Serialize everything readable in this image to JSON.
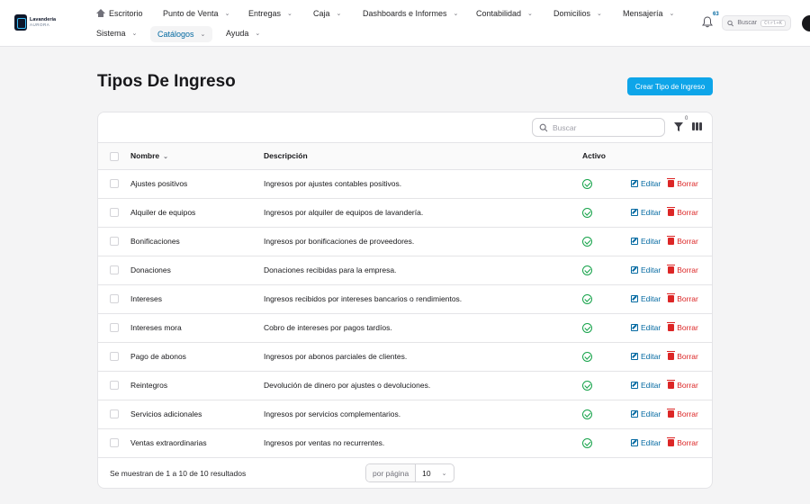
{
  "brand": {
    "name_line1": "Lavandería",
    "name_line2": "AURORA"
  },
  "nav": {
    "items": [
      {
        "label": "Escritorio"
      },
      {
        "label": "Punto de Venta"
      },
      {
        "label": "Entregas"
      },
      {
        "label": "Caja"
      },
      {
        "label": "Dashboards e Informes"
      },
      {
        "label": "Contabilidad"
      },
      {
        "label": "Domicilios"
      },
      {
        "label": "Mensajería"
      },
      {
        "label": "Sistema"
      },
      {
        "label": "Catálogos"
      },
      {
        "label": "Ayuda"
      }
    ],
    "active": "Catálogos",
    "notifications_count": "63",
    "search_label": "Buscar",
    "search_shortcut": "Ctrl+K"
  },
  "page": {
    "title": "Tipos De Ingreso",
    "create_button": "Crear Tipo de Ingreso"
  },
  "table": {
    "search_placeholder": "Buscar",
    "filter_count": "0",
    "columns": {
      "name": "Nombre",
      "description": "Descripción",
      "active": "Activo"
    },
    "edit_label": "Editar",
    "delete_label": "Borrar",
    "rows": [
      {
        "name": "Ajustes positivos",
        "description": "Ingresos por ajustes contables positivos.",
        "active": true
      },
      {
        "name": "Alquiler de equipos",
        "description": "Ingresos por alquiler de equipos de lavandería.",
        "active": true
      },
      {
        "name": "Bonificaciones",
        "description": "Ingresos por bonificaciones de proveedores.",
        "active": true
      },
      {
        "name": "Donaciones",
        "description": "Donaciones recibidas para la empresa.",
        "active": true
      },
      {
        "name": "Intereses",
        "description": "Ingresos recibidos por intereses bancarios o rendimientos.",
        "active": true
      },
      {
        "name": "Intereses mora",
        "description": "Cobro de intereses por pagos tardíos.",
        "active": true
      },
      {
        "name": "Pago de abonos",
        "description": "Ingresos por abonos parciales de clientes.",
        "active": true
      },
      {
        "name": "Reintegros",
        "description": "Devolución de dinero por ajustes o devoluciones.",
        "active": true
      },
      {
        "name": "Servicios adicionales",
        "description": "Ingresos por servicios complementarios.",
        "active": true
      },
      {
        "name": "Ventas extraordinarias",
        "description": "Ingresos por ventas no recurrentes.",
        "active": true
      }
    ],
    "results_text": "Se muestran de 1 a 10 de 10 resultados",
    "per_page_label": "por página",
    "per_page_value": "10"
  },
  "colors": {
    "accent": "#0ea5e9",
    "link": "#0369a1",
    "danger": "#dc2626",
    "success": "#16a34a"
  }
}
